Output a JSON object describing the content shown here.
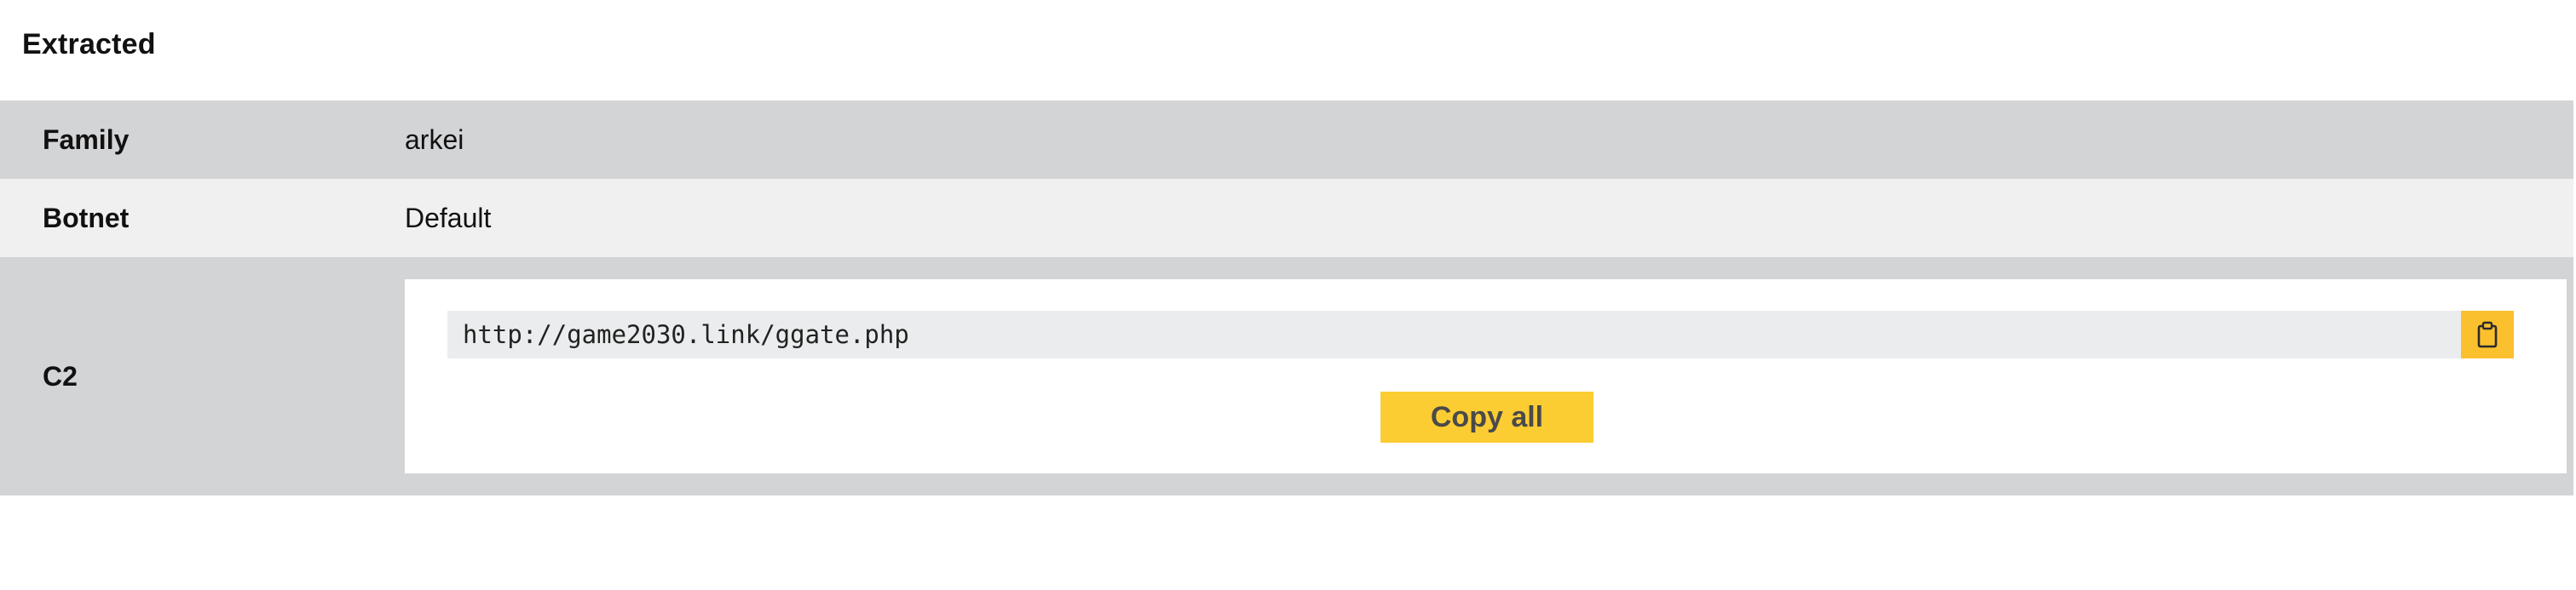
{
  "section": {
    "title": "Extracted"
  },
  "rows": [
    {
      "label": "Family",
      "value": "arkei"
    },
    {
      "label": "Botnet",
      "value": "Default"
    },
    {
      "label": "C2",
      "urls": [
        "http://game2030.link/ggate.php"
      ]
    }
  ],
  "buttons": {
    "copy_all_label": "Copy all",
    "copy_icon": "clipboard-icon"
  },
  "colors": {
    "accent": "#fbc02d",
    "row_dark": "#d3d4d6",
    "row_light": "#f0f0f0",
    "url_background": "#ebeced"
  }
}
